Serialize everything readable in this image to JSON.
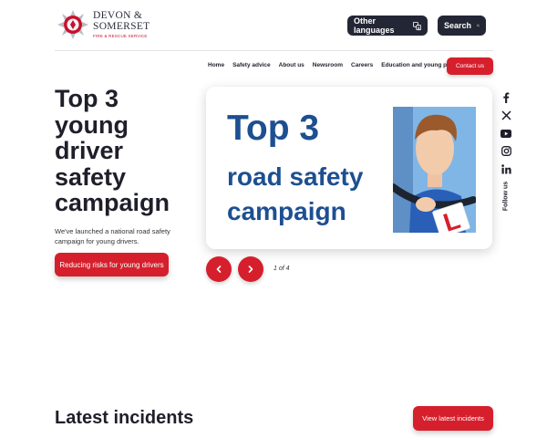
{
  "logo": {
    "line1": "DEVON &",
    "line2": "SOMERSET",
    "line3": "FIRE & RESCUE SERVICE"
  },
  "header": {
    "other_languages_label": "Other languages",
    "search_label": "Search"
  },
  "nav": {
    "items": [
      "Home",
      "Safety advice",
      "About us",
      "Newsroom",
      "Careers",
      "Education and young people"
    ],
    "contact_label": "Contact us"
  },
  "hero": {
    "title_lines": [
      "Top 3",
      "young",
      "driver",
      "safety",
      "campaign"
    ],
    "description": "We've launched a national road safety campaign for young drivers.",
    "cta_label": "Reducing risks for young drivers"
  },
  "slide": {
    "title": "Top 3",
    "subtitle_line1": "road safety",
    "subtitle_line2": "campaign",
    "counter": "1 of 4",
    "learner_plate_letter": "L"
  },
  "social": {
    "icons": [
      "facebook-icon",
      "x-icon",
      "youtube-icon",
      "instagram-icon",
      "linkedin-icon"
    ],
    "follow_label": "Follow us"
  },
  "latest": {
    "heading": "Latest incidents",
    "button_label": "View latest incidents"
  },
  "colors": {
    "brand_red": "#d61f2c",
    "dark_navy": "#232635",
    "slide_blue": "#1d4f91"
  }
}
